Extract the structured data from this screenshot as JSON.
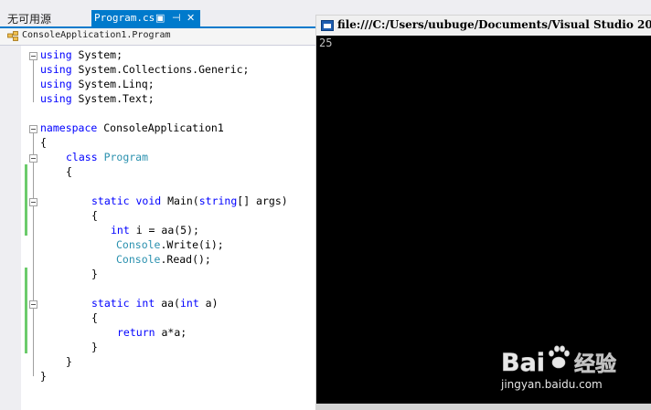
{
  "tabs": {
    "other_label": "无可用源",
    "active_label": "Program.cs"
  },
  "navbar": {
    "path": "ConsoleApplication1.Program"
  },
  "code_lines": [
    [
      {
        "t": "using",
        "c": "kw"
      },
      {
        "t": " System;",
        "c": ""
      }
    ],
    [
      {
        "t": "using",
        "c": "kw"
      },
      {
        "t": " System.Collections.Generic;",
        "c": ""
      }
    ],
    [
      {
        "t": "using",
        "c": "kw"
      },
      {
        "t": " System.Linq;",
        "c": ""
      }
    ],
    [
      {
        "t": "using",
        "c": "kw"
      },
      {
        "t": " System.Text;",
        "c": ""
      }
    ],
    [
      {
        "t": "namespace",
        "c": "kw"
      },
      {
        "t": " ConsoleApplication1",
        "c": ""
      }
    ],
    [
      {
        "t": "{",
        "c": ""
      }
    ],
    [
      {
        "t": "class",
        "c": "kw"
      },
      {
        "t": " ",
        "c": ""
      },
      {
        "t": "Program",
        "c": "ty"
      }
    ],
    [
      {
        "t": "{",
        "c": ""
      }
    ],
    [
      {
        "t": "static",
        "c": "kw"
      },
      {
        "t": " ",
        "c": ""
      },
      {
        "t": "void",
        "c": "kw"
      },
      {
        "t": " Main(",
        "c": ""
      },
      {
        "t": "string",
        "c": "kw"
      },
      {
        "t": "[] args)",
        "c": ""
      }
    ],
    [
      {
        "t": "{",
        "c": ""
      }
    ],
    [
      {
        "t": "int",
        "c": "kw"
      },
      {
        "t": " i = aa(5);",
        "c": ""
      }
    ],
    [
      {
        "t": "Console",
        "c": "ty"
      },
      {
        "t": ".Write(i);",
        "c": ""
      }
    ],
    [
      {
        "t": "Console",
        "c": "ty"
      },
      {
        "t": ".Read();",
        "c": ""
      }
    ],
    [
      {
        "t": "}",
        "c": ""
      }
    ],
    [
      {
        "t": "static",
        "c": "kw"
      },
      {
        "t": " ",
        "c": ""
      },
      {
        "t": "int",
        "c": "kw"
      },
      {
        "t": " aa(",
        "c": ""
      },
      {
        "t": "int",
        "c": "kw"
      },
      {
        "t": " a)",
        "c": ""
      }
    ],
    [
      {
        "t": "{",
        "c": ""
      }
    ],
    [
      {
        "t": "return",
        "c": "kw"
      },
      {
        "t": " a*a;",
        "c": ""
      }
    ],
    [
      {
        "t": "}",
        "c": ""
      }
    ],
    [
      {
        "t": "}",
        "c": ""
      }
    ],
    [
      {
        "t": "}",
        "c": ""
      }
    ]
  ],
  "console": {
    "title": "file:///C:/Users/uubuge/Documents/Visual Studio 20",
    "output": "25"
  },
  "watermark": {
    "logo_text": "Bai 经验",
    "url": "jingyan.baidu.com"
  },
  "colors": {
    "accent": "#007acc",
    "keyword": "#0000ff",
    "type": "#2b91af",
    "change_bar": "#6ccb6c",
    "console_bg": "#000000",
    "console_fg": "#c0c0c0"
  }
}
